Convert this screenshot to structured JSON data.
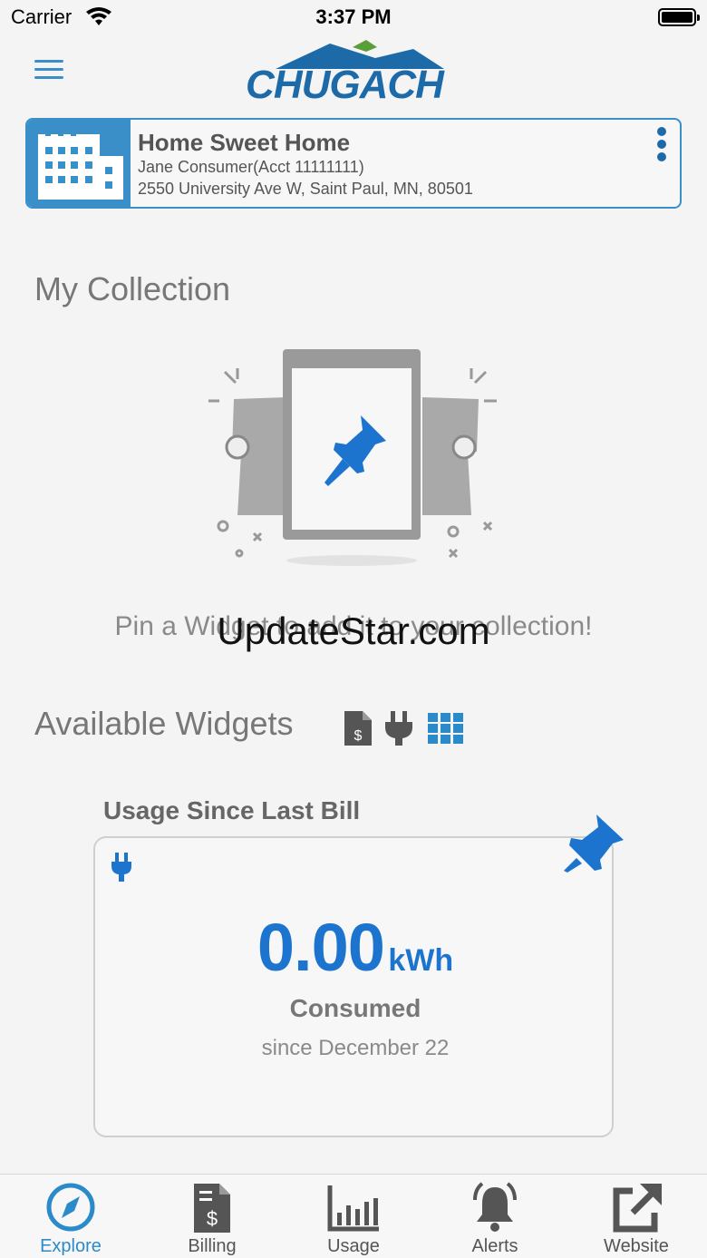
{
  "status_bar": {
    "carrier": "Carrier",
    "time": "3:37 PM"
  },
  "header": {
    "logo_text": "CHUGACH"
  },
  "account": {
    "name": "Home Sweet Home",
    "holder": "Jane Consumer(Acct 11111111)",
    "address": "2550 University Ave W, Saint Paul, MN, 80501"
  },
  "collection": {
    "title": "My Collection",
    "hint": "Pin a Widget to add it to your collection!"
  },
  "watermark": "UpdateStar.com",
  "available": {
    "title": "Available Widgets",
    "filters": [
      {
        "icon": "billing-doc-icon"
      },
      {
        "icon": "plug-icon"
      },
      {
        "icon": "grid-icon"
      }
    ]
  },
  "widget": {
    "heading": "Usage Since Last Bill",
    "value": "0.00",
    "unit": "kWh",
    "label": "Consumed",
    "since": "since December 22"
  },
  "tabs": [
    {
      "label": "Explore",
      "icon": "compass-icon",
      "active": true
    },
    {
      "label": "Billing",
      "icon": "billing-icon",
      "active": false
    },
    {
      "label": "Usage",
      "icon": "bar-chart-icon",
      "active": false
    },
    {
      "label": "Alerts",
      "icon": "bell-icon",
      "active": false
    },
    {
      "label": "Website",
      "icon": "external-link-icon",
      "active": false
    }
  ],
  "colors": {
    "accent": "#3a8fc9",
    "brand_blue": "#1d6aa9",
    "usage_blue": "#1d74cf",
    "background": "#f4f4f4"
  }
}
